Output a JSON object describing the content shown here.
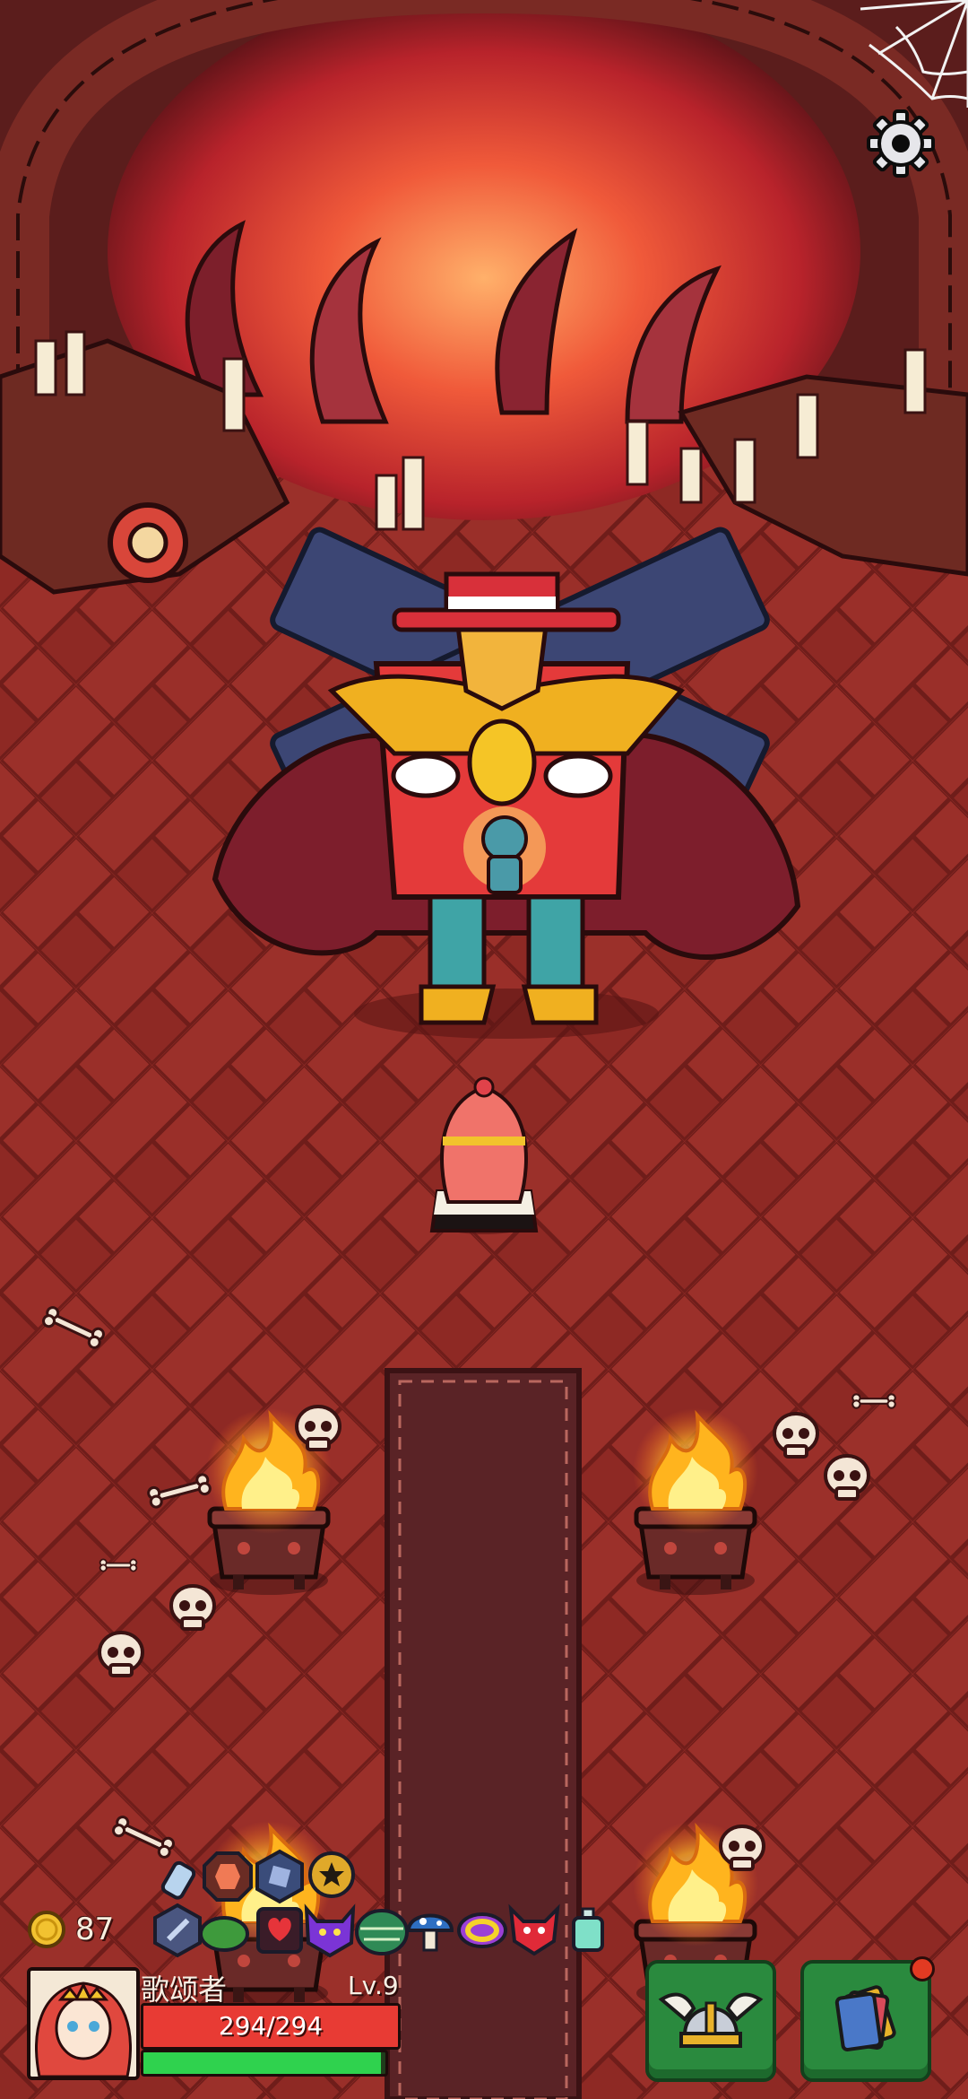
{
  "hud": {
    "coins": "87",
    "player_name": "歌颂者",
    "level": "Lv.9",
    "hp_text": "294/294",
    "hp_fraction": 1.0,
    "xp_fraction": 0.98,
    "settings_icon": "gear-icon",
    "equipment_icon": "winged-helmet-icon",
    "cards_icon": "cards-icon",
    "cards_has_notification": true
  },
  "colors": {
    "floor": "#8f2a25",
    "hp": "#e83b34",
    "xp": "#2fd24e",
    "button": "#2a8a3e",
    "carpet": "#5a2326"
  },
  "items": [
    "fist-icon",
    "octagon-rune-icon",
    "hexagon-rune-icon",
    "flower-icon",
    "sword-rune-icon",
    "green-slime-icon",
    "heart-rune-icon",
    "purple-demon-icon",
    "green-shell-icon",
    "mushroom-icon",
    "gold-ring-icon",
    "red-demon-icon",
    "potion-bottle-icon"
  ]
}
